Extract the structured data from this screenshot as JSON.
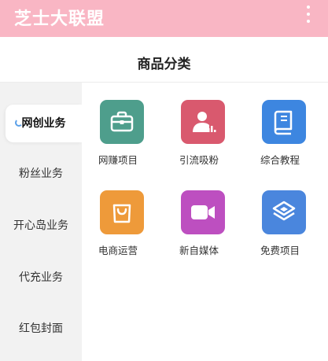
{
  "app": {
    "title": "芝士大联盟",
    "menu_icon": "more-vertical-icon"
  },
  "page": {
    "title": "商品分类"
  },
  "sidebar": {
    "items": [
      {
        "label": "网创业务",
        "active": true
      },
      {
        "label": "粉丝业务",
        "active": false
      },
      {
        "label": "开心岛业务",
        "active": false
      },
      {
        "label": "代充业务",
        "active": false
      },
      {
        "label": "红包封面",
        "active": false
      }
    ]
  },
  "categories": [
    {
      "label": "网赚项目",
      "icon": "briefcase-icon",
      "color": "#4e9e8c"
    },
    {
      "label": "引流吸粉",
      "icon": "user-chart-icon",
      "color": "#d9596e"
    },
    {
      "label": "综合教程",
      "icon": "book-icon",
      "color": "#3d86e0"
    },
    {
      "label": "电商运营",
      "icon": "shopping-bag-icon",
      "color": "#ee9a3a"
    },
    {
      "label": "新自媒体",
      "icon": "video-camera-icon",
      "color": "#bd4fc0"
    },
    {
      "label": "免费项目",
      "icon": "layers-icon",
      "color": "#4a86dd"
    }
  ]
}
